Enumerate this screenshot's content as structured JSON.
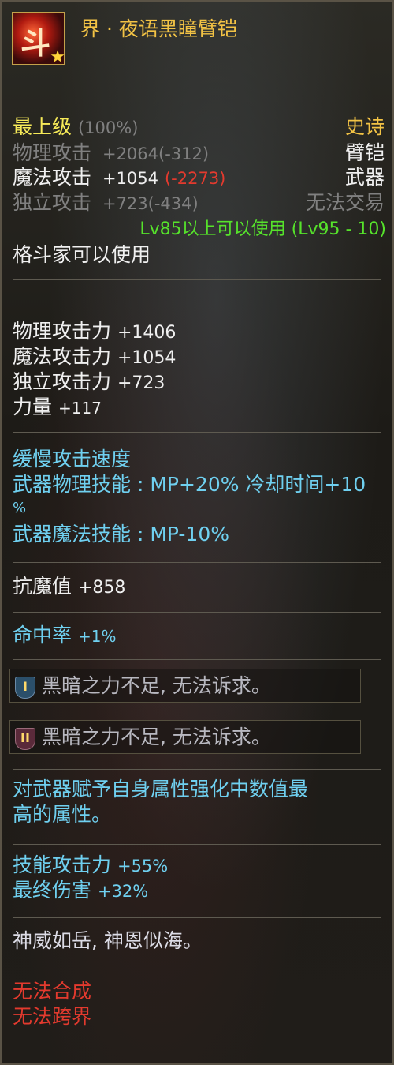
{
  "item": {
    "name": "界 · 夜语黑瞳臂铠",
    "grade_label": "最上级",
    "grade_percent": "(100%)",
    "rarity": "史诗",
    "slot": "臂铠",
    "category": "武器",
    "trade": "无法交易",
    "icon_name": "armguard-item-icon"
  },
  "base_stats": [
    {
      "name": "物理攻击",
      "value": "+2064",
      "diff": "(-312)"
    },
    {
      "name": "魔法攻击",
      "value": "+1054",
      "diff": "(-2273)"
    },
    {
      "name": "独立攻击",
      "value": "+723",
      "diff": "(-434)"
    }
  ],
  "level_req": "Lv85以上可以使用 (Lv95 - 10)",
  "class_req": "格斗家可以使用",
  "attack_stats": [
    {
      "name": "物理攻击力",
      "value": "+1406"
    },
    {
      "name": "魔法攻击力",
      "value": "+1054"
    },
    {
      "name": "独立攻击力",
      "value": "+723"
    },
    {
      "name": "力量",
      "value": "+117"
    }
  ],
  "skills": {
    "speed": "缓慢攻击速度",
    "phys_line1": "武器物理技能 : MP+20% 冷却时间+10",
    "phys_line2": "%",
    "magic": "武器魔法技能 : MP-10%"
  },
  "anti_magic": {
    "label": "抗魔值",
    "value": "+858"
  },
  "hit_rate": {
    "label": "命中率",
    "value": "+1%"
  },
  "sockets": [
    {
      "badge": "I",
      "text": "黑暗之力不足, 无法诉求。"
    },
    {
      "badge": "II",
      "text": "黑暗之力不足, 无法诉求。"
    }
  ],
  "element": {
    "line1": "对武器赋予自身属性强化中数值最",
    "line2": "高的属性。"
  },
  "bonus": [
    {
      "name": "技能攻击力",
      "value": "+55%"
    },
    {
      "name": "最终伤害",
      "value": "+32%"
    }
  ],
  "flavor": "神威如岳, 神恩似海。",
  "restrictions": [
    "无法合成",
    "无法跨界"
  ],
  "colors": {
    "gold": "#f3c345",
    "grade_yellow": "#f6ea58",
    "stat_grey": "#808080",
    "diff_red": "#e33a2e",
    "req_green": "#56e32b",
    "skill_cyan": "#6fd0f0",
    "restriction_red": "#e33a2e"
  }
}
